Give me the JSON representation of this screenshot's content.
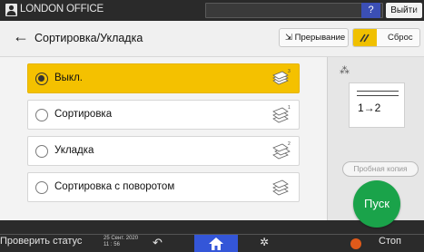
{
  "topbar": {
    "office": "LONDON OFFICE",
    "help_label": "?",
    "exit_label": "Выйти",
    "night_icon_label": "C"
  },
  "header": {
    "title": "Сортировка/Укладка",
    "interrupt_label": "Прерывание",
    "reset_label": "Сброс"
  },
  "options": [
    {
      "label": "Выкл.",
      "selected": true
    },
    {
      "label": "Сортировка",
      "selected": false
    },
    {
      "label": "Укладка",
      "selected": false
    },
    {
      "label": "Сортировка с поворотом",
      "selected": false
    }
  ],
  "right_panel": {
    "preview_text": "1→2",
    "trial_label": "Пробная копия",
    "start_label": "Пуск"
  },
  "bottombar": {
    "status_label": "Проверить статус",
    "date": "25 Сент. 2020",
    "time": "11 : 56",
    "stop_label": "Стоп"
  },
  "colors": {
    "accent_yellow": "#f4c100",
    "start_green": "#1aa34a",
    "home_blue": "#3456d8",
    "stop_orange": "#e05a1a"
  }
}
